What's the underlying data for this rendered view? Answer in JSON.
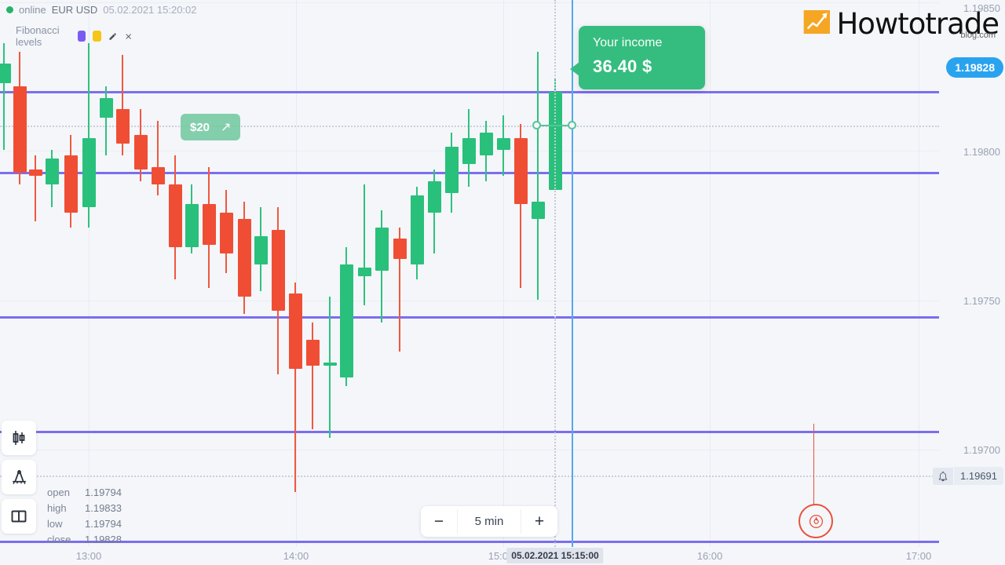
{
  "header": {
    "status_label": "online",
    "symbol": "EUR USD",
    "timestamp": "05.02.2021 15:20:02",
    "indicator_label": "Fibonacci levels",
    "swatch_purple": "#7b5cf0",
    "swatch_yellow": "#f5c518",
    "edit_icon": "pencil-icon",
    "close_icon": "close-icon"
  },
  "logo": {
    "text": "Howtotrade",
    "subtext": "blog.com",
    "mark_color": "#f5a623"
  },
  "tooltip": {
    "label": "Your income",
    "value": "36.40 $",
    "bg": "#35bd7f"
  },
  "position_badge": {
    "amount": "$20",
    "direction_icon": "arrow-up-right-icon"
  },
  "price_axis": {
    "labels": [
      "1.19850",
      "1.19800",
      "1.19750",
      "1.19700"
    ],
    "current_price": "1.19828",
    "current_price_color": "#2aa3ef",
    "alert_price": "1.19691",
    "alert_icon": "bell-icon"
  },
  "time_axis": {
    "labels": [
      "13:00",
      "14:00",
      "15:00",
      "16:00",
      "17:00"
    ],
    "current_time_badge": "05.02.2021 15:15:00"
  },
  "ohlc": {
    "rows": [
      {
        "key": "open",
        "value": "1.19794"
      },
      {
        "key": "high",
        "value": "1.19833"
      },
      {
        "key": "low",
        "value": "1.19794"
      },
      {
        "key": "close",
        "value": "1.19828"
      }
    ]
  },
  "timeframe": {
    "decrease_label": "−",
    "value": "5 min",
    "increase_label": "+"
  },
  "tools": [
    {
      "icon": "candlestick-chart-icon"
    },
    {
      "icon": "drawing-compass-icon"
    },
    {
      "icon": "split-layout-icon"
    }
  ],
  "expiry_marker": {
    "icon": "flame-icon",
    "color": "#e8513a"
  },
  "chart_data": {
    "type": "candlestick",
    "title": "EUR USD 5 min",
    "xlabel": "",
    "ylabel": "",
    "ylim": [
      1.1967,
      1.1986
    ],
    "xlim": [
      "12:45",
      "17:10"
    ],
    "grid": true,
    "up_color": "#29c07b",
    "down_color": "#ef4e35",
    "fib_levels": [
      1.19828,
      1.198,
      1.1975,
      1.1971,
      1.19672
    ],
    "fib_color": "#7b6ef0",
    "entry_price": 1.19808,
    "entry_time": "15:15:00",
    "candles": [
      {
        "x": 5,
        "o": 1.19831,
        "h": 1.19845,
        "l": 1.19808,
        "c": 1.19838,
        "dir": "up"
      },
      {
        "x": 25,
        "o": 1.1983,
        "h": 1.19842,
        "l": 1.19796,
        "c": 1.198,
        "dir": "down"
      },
      {
        "x": 45,
        "o": 1.19801,
        "h": 1.19806,
        "l": 1.19783,
        "c": 1.19799,
        "dir": "down"
      },
      {
        "x": 66,
        "o": 1.19796,
        "h": 1.19808,
        "l": 1.19788,
        "c": 1.19805,
        "dir": "up"
      },
      {
        "x": 90,
        "o": 1.19806,
        "h": 1.19813,
        "l": 1.19781,
        "c": 1.19786,
        "dir": "down"
      },
      {
        "x": 113,
        "o": 1.19788,
        "h": 1.19845,
        "l": 1.19781,
        "c": 1.19812,
        "dir": "up"
      },
      {
        "x": 135,
        "o": 1.19819,
        "h": 1.1983,
        "l": 1.19806,
        "c": 1.19826,
        "dir": "up"
      },
      {
        "x": 156,
        "o": 1.19822,
        "h": 1.19841,
        "l": 1.19806,
        "c": 1.1981,
        "dir": "down"
      },
      {
        "x": 179,
        "o": 1.19813,
        "h": 1.19822,
        "l": 1.19797,
        "c": 1.19801,
        "dir": "down"
      },
      {
        "x": 201,
        "o": 1.19802,
        "h": 1.19818,
        "l": 1.19792,
        "c": 1.19796,
        "dir": "down"
      },
      {
        "x": 223,
        "o": 1.19796,
        "h": 1.19806,
        "l": 1.19763,
        "c": 1.19774,
        "dir": "down"
      },
      {
        "x": 244,
        "o": 1.19774,
        "h": 1.19796,
        "l": 1.19772,
        "c": 1.19789,
        "dir": "up"
      },
      {
        "x": 266,
        "o": 1.19789,
        "h": 1.19802,
        "l": 1.1976,
        "c": 1.19775,
        "dir": "down"
      },
      {
        "x": 288,
        "o": 1.19786,
        "h": 1.19794,
        "l": 1.19765,
        "c": 1.19772,
        "dir": "down"
      },
      {
        "x": 311,
        "o": 1.19784,
        "h": 1.1979,
        "l": 1.19751,
        "c": 1.19757,
        "dir": "down"
      },
      {
        "x": 332,
        "o": 1.19778,
        "h": 1.19788,
        "l": 1.19759,
        "c": 1.19768,
        "dir": "up"
      },
      {
        "x": 354,
        "o": 1.1978,
        "h": 1.19788,
        "l": 1.1973,
        "c": 1.19752,
        "dir": "down"
      },
      {
        "x": 376,
        "o": 1.19758,
        "h": 1.19762,
        "l": 1.19689,
        "c": 1.19732,
        "dir": "down"
      },
      {
        "x": 398,
        "o": 1.19742,
        "h": 1.19748,
        "l": 1.19711,
        "c": 1.19733,
        "dir": "down"
      },
      {
        "x": 420,
        "o": 1.19733,
        "h": 1.19757,
        "l": 1.19708,
        "c": 1.19734,
        "dir": "up"
      },
      {
        "x": 441,
        "o": 1.19729,
        "h": 1.19774,
        "l": 1.19726,
        "c": 1.19768,
        "dir": "up"
      },
      {
        "x": 464,
        "o": 1.19764,
        "h": 1.19796,
        "l": 1.19754,
        "c": 1.19767,
        "dir": "up"
      },
      {
        "x": 486,
        "o": 1.19766,
        "h": 1.19787,
        "l": 1.19748,
        "c": 1.19781,
        "dir": "up"
      },
      {
        "x": 509,
        "o": 1.19777,
        "h": 1.19781,
        "l": 1.19738,
        "c": 1.1977,
        "dir": "down"
      },
      {
        "x": 531,
        "o": 1.19768,
        "h": 1.19795,
        "l": 1.19763,
        "c": 1.19792,
        "dir": "up"
      },
      {
        "x": 553,
        "o": 1.19786,
        "h": 1.19801,
        "l": 1.19772,
        "c": 1.19797,
        "dir": "up"
      },
      {
        "x": 575,
        "o": 1.19793,
        "h": 1.19814,
        "l": 1.19786,
        "c": 1.19809,
        "dir": "up"
      },
      {
        "x": 597,
        "o": 1.19803,
        "h": 1.19822,
        "l": 1.19795,
        "c": 1.19812,
        "dir": "up"
      },
      {
        "x": 619,
        "o": 1.19806,
        "h": 1.19818,
        "l": 1.19797,
        "c": 1.19814,
        "dir": "up"
      },
      {
        "x": 641,
        "o": 1.19812,
        "h": 1.1982,
        "l": 1.19799,
        "c": 1.19808,
        "dir": "up"
      },
      {
        "x": 663,
        "o": 1.19812,
        "h": 1.19817,
        "l": 1.1976,
        "c": 1.19789,
        "dir": "down"
      },
      {
        "x": 685,
        "o": 1.19784,
        "h": 1.19842,
        "l": 1.19756,
        "c": 1.1979,
        "dir": "up"
      },
      {
        "x": 707,
        "o": 1.19794,
        "h": 1.19833,
        "l": 1.19794,
        "c": 1.19828,
        "dir": "up"
      }
    ]
  }
}
